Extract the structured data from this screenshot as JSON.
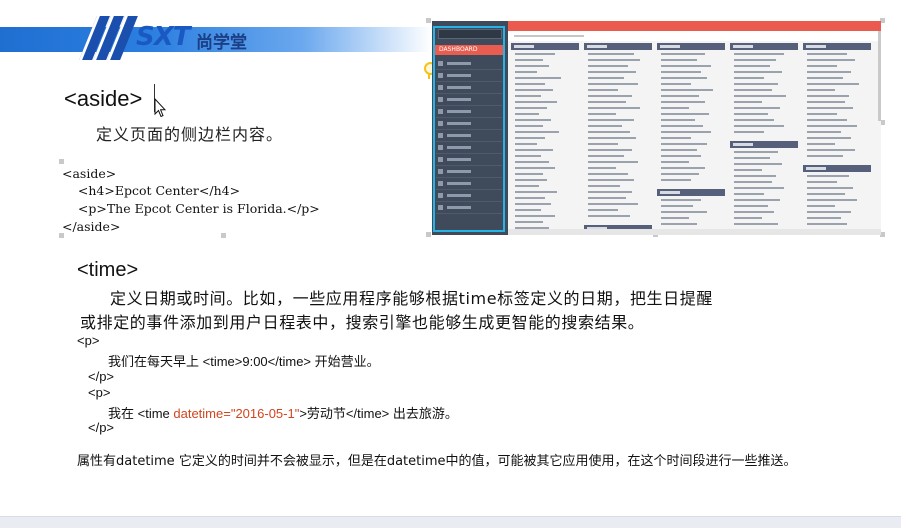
{
  "header": {
    "logo_text": "SXT",
    "logo_cn": "尚学堂"
  },
  "aside_section": {
    "title": "<aside>",
    "description": "定义页面的侧边栏内容。",
    "code": [
      "<aside>",
      "    <h4>Epcot Center</h4>",
      "    <p>The Epcot Center is Florida.</p>",
      "</aside>"
    ]
  },
  "embedded_screenshot": {
    "active_menu": "DASHBOARD"
  },
  "time_section": {
    "title": "<time>",
    "description_line1": "定义日期或时间。比如，一些应用程序能够根据time标签定义的日期，把生日提醒",
    "description_line2": "或排定的事件添加到用户日程表中，搜索引擎也能够生成更智能的搜索结果。",
    "ex1_open": "<p>",
    "ex1_text_a": "我们在每天早上 <time>9:00</time> 开始营业。",
    "ex1_close": "</p>",
    "ex2_open": "<p>",
    "ex2_text_a": "我在 <time ",
    "ex2_attr": "datetime=\"2016-05-1\"",
    "ex2_text_b": ">劳动节</time> 出去旅游。",
    "ex2_close": "</p>",
    "note": "属性有datetime  它定义的时间并不会被显示，但是在datetime中的值，可能被其它应用使用，在这个时间段进行一些推送。"
  },
  "colors": {
    "brand_blue": "#1f6fd1",
    "attr_orange": "#d2451d",
    "shot_red": "#ea5a4f",
    "shot_sidebar": "#3f4b5b"
  }
}
